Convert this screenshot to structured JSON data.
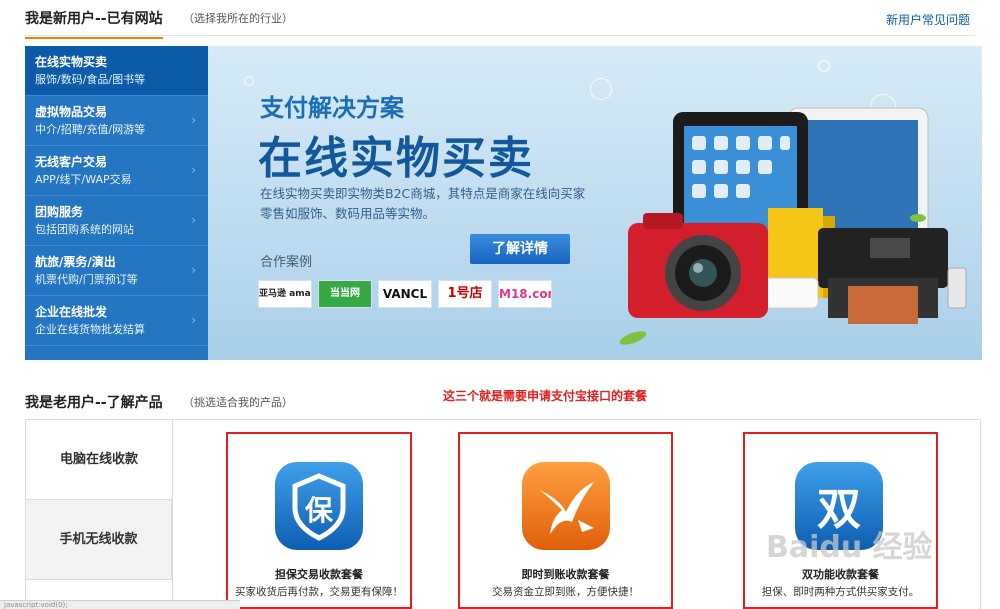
{
  "new_user": {
    "title": "我是新用户--已有网站",
    "hint": "（选择我所在的行业）",
    "faq_link": "新用户常见问题"
  },
  "sidebar": {
    "items": [
      {
        "name": "在线实物买卖",
        "desc": "服饰/数码/食品/图书等"
      },
      {
        "name": "虚拟物品交易",
        "desc": "中介/招聘/充值/网游等"
      },
      {
        "name": "无线客户交易",
        "desc": "APP/线下/WAP交易"
      },
      {
        "name": "团购服务",
        "desc": "包括团购系统的网站"
      },
      {
        "name": "航旅/票务/演出",
        "desc": "机票代购/门票预订等"
      },
      {
        "name": "企业在线批发",
        "desc": "企业在线货物批发结算"
      }
    ],
    "arrow": "›"
  },
  "banner": {
    "subtitle": "支付解决方案",
    "headline": "在线实物买卖",
    "text": "在线实物买卖即实物类B2C商城，其特点是商家在线向买家零售如服饰、数码用品等实物。",
    "button": "了解详情",
    "partners_label": "合作案例",
    "partners": [
      "亚马逊 amazon.cn",
      "当当网",
      "VANCL",
      "1号店",
      "M18.com"
    ]
  },
  "old_user": {
    "title": "我是老用户--了解产品",
    "hint": "（挑选适合我的产品）",
    "note": "这三个就是需要申请支付宝接口的套餐"
  },
  "tabs": [
    "电脑在线收款",
    "手机无线收款"
  ],
  "packages": [
    {
      "name": "担保交易收款套餐",
      "desc": "买家收货后再付款，交易更有保障！",
      "glyph": "保",
      "color": "#1a7bd0"
    },
    {
      "name": "即时到账收款套餐",
      "desc": "交易资金立即到账，方便快捷！",
      "glyph": "",
      "color": "#f07a18"
    },
    {
      "name": "双功能收款套餐",
      "desc": "担保、即时两种方式供买家支付。",
      "glyph": "双",
      "color": "#1a7bd0"
    }
  ],
  "status_bar": "javascript:void(0);",
  "watermark": "Baidu 经验",
  "colors": {
    "accent_orange": "#f08200",
    "sidebar_blue": "#2576c2",
    "link_blue": "#0a5fa8",
    "annotation_red": "#e02020"
  }
}
